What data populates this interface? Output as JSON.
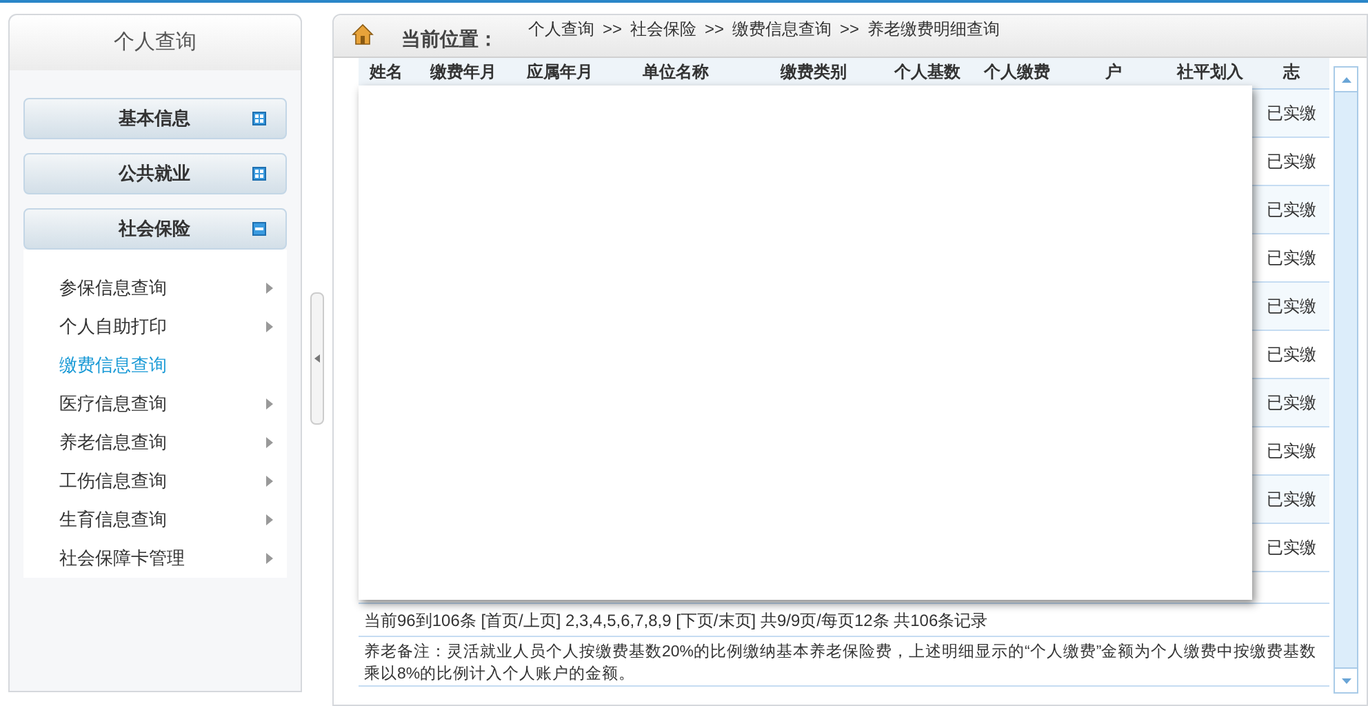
{
  "sidebar": {
    "title": "个人查询",
    "sections": [
      {
        "label": "基本信息",
        "expanded": false
      },
      {
        "label": "公共就业",
        "expanded": false
      },
      {
        "label": "社会保险",
        "expanded": true,
        "items": [
          {
            "label": "参保信息查询",
            "selected": false
          },
          {
            "label": "个人自助打印",
            "selected": false
          },
          {
            "label": "缴费信息查询",
            "selected": true
          },
          {
            "label": "医疗信息查询",
            "selected": false
          },
          {
            "label": "养老信息查询",
            "selected": false
          },
          {
            "label": "工伤信息查询",
            "selected": false
          },
          {
            "label": "生育信息查询",
            "selected": false
          },
          {
            "label": "社会保障卡管理",
            "selected": false
          }
        ]
      }
    ]
  },
  "breadcrumb": {
    "label": "当前位置：",
    "path": [
      "个人查询",
      "社会保险",
      "缴费信息查询",
      "养老缴费明细查询"
    ],
    "separator": ">>"
  },
  "table": {
    "columns": [
      "姓名",
      "缴费年月",
      "应属年月",
      "单位名称",
      "缴费类别",
      "个人基数",
      "个人缴费",
      "户",
      "社平划入",
      "志"
    ],
    "rows": [
      {
        "status": "已实缴"
      },
      {
        "status": "已实缴"
      },
      {
        "status": "已实缴"
      },
      {
        "status": "已实缴"
      },
      {
        "status": "已实缴"
      },
      {
        "status": "已实缴"
      },
      {
        "status": "已实缴"
      },
      {
        "status": "已实缴"
      },
      {
        "status": "已实缴"
      },
      {
        "status": "已实缴"
      }
    ]
  },
  "pagination": "当前96到106条 [首页/上页] 2,3,4,5,6,7,8,9 [下页/末页] 共9/9页/每页12条 共106条记录",
  "note": "养老备注：灵活就业人员个人按缴费基数20%的比例缴纳基本养老保险费，上述明细显示的“个人缴费”金额为个人缴费中按缴费基数乘以8%的比例计入个人账户的金额。"
}
